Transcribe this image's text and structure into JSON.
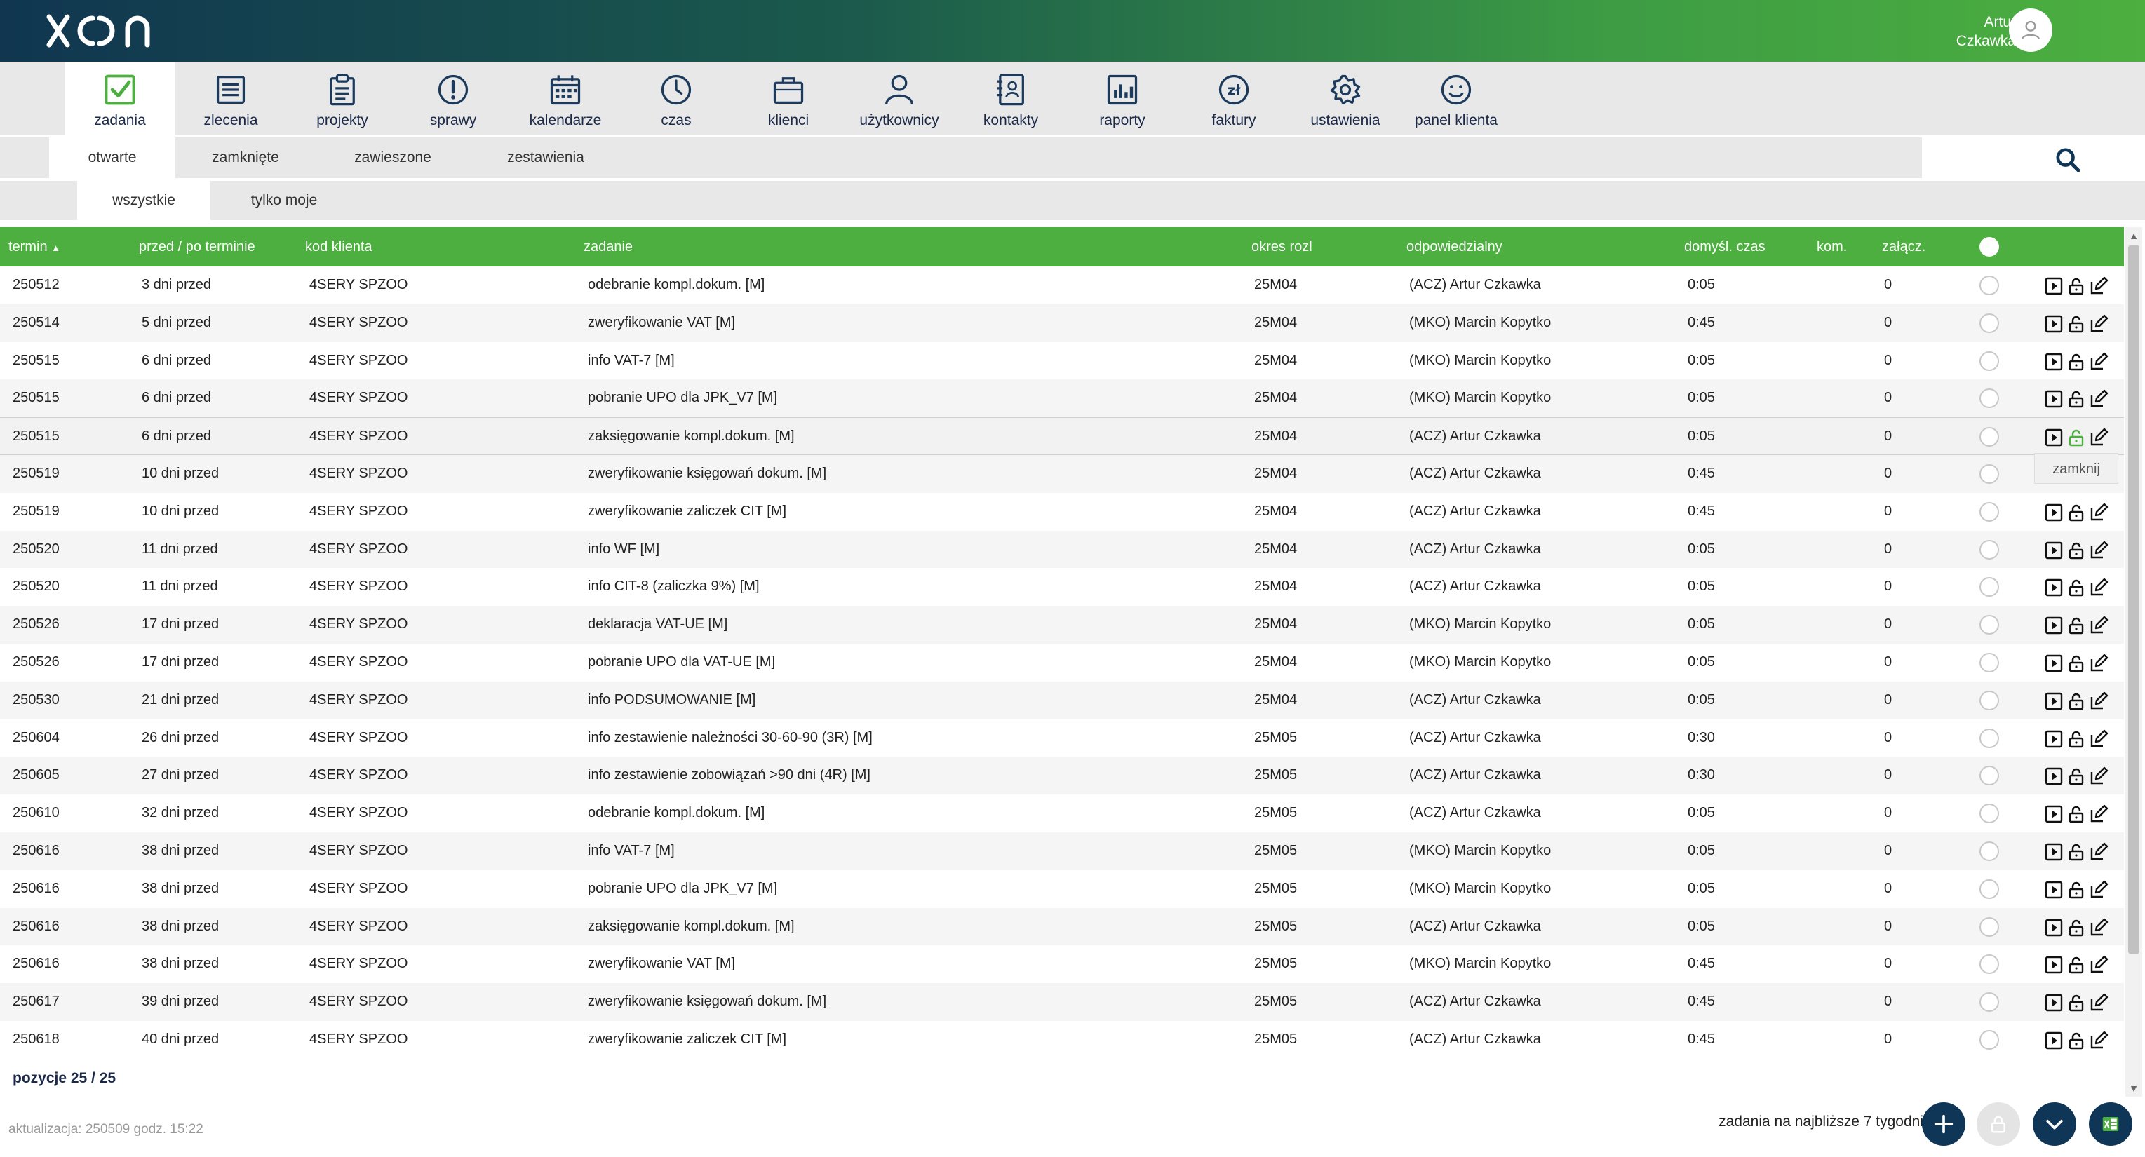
{
  "header": {
    "user_first": "Artur",
    "user_last": "Czkawka"
  },
  "nav": [
    {
      "label": "zadania",
      "icon": "checkbox-icon"
    },
    {
      "label": "zlecenia",
      "icon": "list-icon"
    },
    {
      "label": "projekty",
      "icon": "clipboard-icon"
    },
    {
      "label": "sprawy",
      "icon": "exclamation-icon"
    },
    {
      "label": "kalendarze",
      "icon": "calendar-icon"
    },
    {
      "label": "czas",
      "icon": "clock-icon"
    },
    {
      "label": "klienci",
      "icon": "briefcase-icon"
    },
    {
      "label": "użytkownicy",
      "icon": "user-icon"
    },
    {
      "label": "kontakty",
      "icon": "contacts-icon"
    },
    {
      "label": "raporty",
      "icon": "report-icon"
    },
    {
      "label": "faktury",
      "icon": "invoice-icon"
    },
    {
      "label": "ustawienia",
      "icon": "gear-icon"
    },
    {
      "label": "panel klienta",
      "icon": "smiley-icon"
    }
  ],
  "subtabs": [
    "otwarte",
    "zamknięte",
    "zawieszone",
    "zestawienia"
  ],
  "filtertabs": [
    "wszystkie",
    "tylko moje"
  ],
  "table": {
    "columns": {
      "termin": "termin",
      "przed": "przed / po terminie",
      "kod": "kod klienta",
      "zadanie": "zadanie",
      "okres": "okres rozl",
      "odp": "odpowiedzialny",
      "czas": "domyśl. czas",
      "kom": "kom.",
      "zal": "załącz."
    },
    "sort_indicator": "▲",
    "rows": [
      [
        "250512",
        "3 dni przed",
        "4SERY SPZOO",
        "odebranie kompl.dokum. [M]",
        "25M04",
        "(ACZ) Artur Czkawka",
        "0:05",
        "0"
      ],
      [
        "250514",
        "5 dni przed",
        "4SERY SPZOO",
        "zweryfikowanie VAT [M]",
        "25M04",
        "(MKO) Marcin Kopytko",
        "0:45",
        "0"
      ],
      [
        "250515",
        "6 dni przed",
        "4SERY SPZOO",
        "info VAT-7 [M]",
        "25M04",
        "(MKO) Marcin Kopytko",
        "0:05",
        "0"
      ],
      [
        "250515",
        "6 dni przed",
        "4SERY SPZOO",
        "pobranie UPO dla JPK_V7 [M]",
        "25M04",
        "(MKO) Marcin Kopytko",
        "0:05",
        "0"
      ],
      [
        "250515",
        "6 dni przed",
        "4SERY SPZOO",
        "zaksięgowanie kompl.dokum. [M]",
        "25M04",
        "(ACZ) Artur Czkawka",
        "0:05",
        "0"
      ],
      [
        "250519",
        "10 dni przed",
        "4SERY SPZOO",
        "zweryfikowanie księgowań dokum. [M]",
        "25M04",
        "(ACZ) Artur Czkawka",
        "0:45",
        "0"
      ],
      [
        "250519",
        "10 dni przed",
        "4SERY SPZOO",
        "zweryfikowanie zaliczek CIT [M]",
        "25M04",
        "(ACZ) Artur Czkawka",
        "0:45",
        "0"
      ],
      [
        "250520",
        "11 dni przed",
        "4SERY SPZOO",
        "info WF [M]",
        "25M04",
        "(ACZ) Artur Czkawka",
        "0:05",
        "0"
      ],
      [
        "250520",
        "11 dni przed",
        "4SERY SPZOO",
        "info CIT-8 (zaliczka 9%) [M]",
        "25M04",
        "(ACZ) Artur Czkawka",
        "0:05",
        "0"
      ],
      [
        "250526",
        "17 dni przed",
        "4SERY SPZOO",
        "deklaracja VAT-UE [M]",
        "25M04",
        "(MKO) Marcin Kopytko",
        "0:05",
        "0"
      ],
      [
        "250526",
        "17 dni przed",
        "4SERY SPZOO",
        "pobranie UPO dla VAT-UE [M]",
        "25M04",
        "(MKO) Marcin Kopytko",
        "0:05",
        "0"
      ],
      [
        "250530",
        "21 dni przed",
        "4SERY SPZOO",
        "info PODSUMOWANIE [M]",
        "25M04",
        "(ACZ) Artur Czkawka",
        "0:05",
        "0"
      ],
      [
        "250604",
        "26 dni przed",
        "4SERY SPZOO",
        "info zestawienie należności 30-60-90 (3R) [M]",
        "25M05",
        "(ACZ) Artur Czkawka",
        "0:30",
        "0"
      ],
      [
        "250605",
        "27 dni przed",
        "4SERY SPZOO",
        "info zestawienie zobowiązań >90 dni (4R) [M]",
        "25M05",
        "(ACZ) Artur Czkawka",
        "0:30",
        "0"
      ],
      [
        "250610",
        "32 dni przed",
        "4SERY SPZOO",
        "odebranie kompl.dokum. [M]",
        "25M05",
        "(ACZ) Artur Czkawka",
        "0:05",
        "0"
      ],
      [
        "250616",
        "38 dni przed",
        "4SERY SPZOO",
        "info VAT-7 [M]",
        "25M05",
        "(MKO) Marcin Kopytko",
        "0:05",
        "0"
      ],
      [
        "250616",
        "38 dni przed",
        "4SERY SPZOO",
        "pobranie UPO dla JPK_V7 [M]",
        "25M05",
        "(MKO) Marcin Kopytko",
        "0:05",
        "0"
      ],
      [
        "250616",
        "38 dni przed",
        "4SERY SPZOO",
        "zaksięgowanie kompl.dokum. [M]",
        "25M05",
        "(ACZ) Artur Czkawka",
        "0:05",
        "0"
      ],
      [
        "250616",
        "38 dni przed",
        "4SERY SPZOO",
        "zweryfikowanie VAT [M]",
        "25M05",
        "(MKO) Marcin Kopytko",
        "0:45",
        "0"
      ],
      [
        "250617",
        "39 dni przed",
        "4SERY SPZOO",
        "zweryfikowanie księgowań dokum. [M]",
        "25M05",
        "(ACZ) Artur Czkawka",
        "0:45",
        "0"
      ],
      [
        "250618",
        "40 dni przed",
        "4SERY SPZOO",
        "zweryfikowanie zaliczek CIT [M]",
        "25M05",
        "(ACZ) Artur Czkawka",
        "0:45",
        "0"
      ]
    ]
  },
  "tooltip": "zamknij",
  "footer": {
    "positions": "pozycje 25 / 25",
    "updated": "aktualizacja: 250509 godz. 15:22",
    "upcoming": "zadania na najbliższe 7 tygodni"
  },
  "colors": {
    "header_green": "#4caf3f",
    "navy": "#0f3657",
    "nav_bg": "#e8e8e8"
  }
}
